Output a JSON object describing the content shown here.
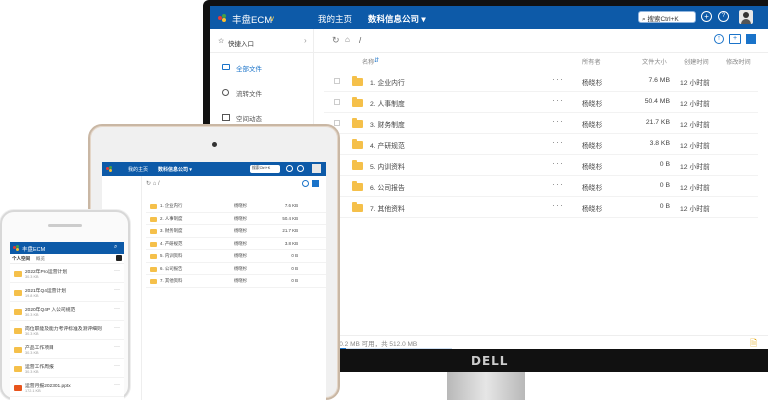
{
  "monitor": {
    "brand": "丰盘ECM",
    "brand_suffix": "v",
    "nav": [
      "我的主页",
      "数科信息公司 ▾"
    ],
    "search_label": "搜索Ctrl+K",
    "sidebar": {
      "header": "快捷入口",
      "items": [
        "全部文件",
        "流转文件",
        "空间动态"
      ]
    },
    "path": "/",
    "columns": [
      "名称",
      "所有者",
      "文件大小",
      "创建时间",
      "修改时间"
    ],
    "rows": [
      {
        "name": "1. 企业内行",
        "owner": "杨晓杉",
        "size": "7.6 MB",
        "time": "12 小时前"
      },
      {
        "name": "2. 人事制度",
        "owner": "杨晓杉",
        "size": "50.4 MB",
        "time": "12 小时前"
      },
      {
        "name": "3. 财务制度",
        "owner": "杨晓杉",
        "size": "21.7 KB",
        "time": "12 小时前"
      },
      {
        "name": "4. 产研规范",
        "owner": "杨晓杉",
        "size": "3.8 KB",
        "time": "12 小时前"
      },
      {
        "name": "5. 内训资料",
        "owner": "杨晓杉",
        "size": "0 B",
        "time": "12 小时前"
      },
      {
        "name": "6. 公司报告",
        "owner": "杨晓杉",
        "size": "0 B",
        "time": "12 小时前"
      },
      {
        "name": "7. 其他资料",
        "owner": "杨晓杉",
        "size": "0 B",
        "time": "12 小时前"
      }
    ],
    "storage": "450.2 MB 可用，共 512.0 MB",
    "storage_used_fraction": 0.12,
    "bezel_logo": "DELL"
  },
  "tablet": {
    "nav": [
      "我的主页",
      "数科信息公司 ▾"
    ],
    "search_label": "搜索Ctrl+K",
    "rows": [
      {
        "name": "1. 企业内行",
        "owner": "杨晓杉",
        "size": "7.6 KB"
      },
      {
        "name": "2. 人事制度",
        "owner": "杨晓杉",
        "size": "50.4 KB"
      },
      {
        "name": "3. 财务制度",
        "owner": "杨晓杉",
        "size": "21.7 KB"
      },
      {
        "name": "4. 产研规范",
        "owner": "杨晓杉",
        "size": "3.8 KB"
      },
      {
        "name": "5. 内训资料",
        "owner": "杨晓杉",
        "size": "0 B"
      },
      {
        "name": "6. 公司报告",
        "owner": "杨晓杉",
        "size": "0 B"
      },
      {
        "name": "7. 其他资料",
        "owner": "杨晓杉",
        "size": "0 B"
      }
    ]
  },
  "phone": {
    "brand": "丰盘ECM",
    "tab_left": "个人空间",
    "tab_right": "概览",
    "items": [
      {
        "name": "2022年Pro运营计划",
        "size": "30.3 KB"
      },
      {
        "name": "2021年Q4运营计划",
        "size": "19.8 KB"
      },
      {
        "name": "2020年Q4P 入公司规范",
        "size": "30.3 KB"
      },
      {
        "name": "岗位职能及能力考评标准及测评细则",
        "size": "30.3 KB"
      },
      {
        "name": "产品工作项目",
        "size": "30.3 KB"
      },
      {
        "name": "运营工作周报",
        "size": "30.3 KB"
      },
      {
        "name": "运营月报202301.pptx",
        "size": "172.1 KB"
      }
    ]
  },
  "colors": {
    "brand_blue": "#0d5aa8",
    "folder": "#f5c04a",
    "accent": "#1a73c9"
  }
}
